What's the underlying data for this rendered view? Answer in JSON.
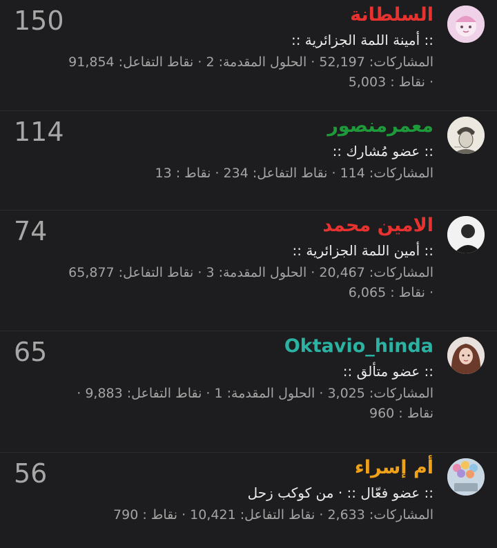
{
  "members": [
    {
      "count": "150",
      "username": "السلطانة",
      "username_color": "#e8322f",
      "title": ":: أمينة اللمة الجزائرية ::",
      "stats_line1": "المشاركات: 52,197 · الحلول المقدمة: 2 · نقاط التفاعل: 91,854",
      "stats_line2": "· نقاط : 5,003",
      "avatar": "pink-cartoon-avatar"
    },
    {
      "count": "114",
      "username": "معمرمنصور",
      "username_color": "#1f9a3b",
      "title": ":: عضو مُشارك ::",
      "stats_line1": "المشاركات: 114 · نقاط التفاعل: 234 · نقاط : 13",
      "stats_line2": "",
      "avatar": "sketch-portrait-avatar"
    },
    {
      "count": "74",
      "username": "الامين محمد",
      "username_color": "#e8322f",
      "title": ":: أمين اللمة الجزائرية ::",
      "stats_line1": "المشاركات: 20,467 · الحلول المقدمة: 3 · نقاط التفاعل: 65,877",
      "stats_line2": "· نقاط : 6,065",
      "avatar": "person-photo-avatar"
    },
    {
      "count": "65",
      "username": "Oktavio_hinda",
      "username_color": "#2ab3a3",
      "title": ":: عضو متألق ::",
      "stats_line1": "المشاركات: 3,025 · الحلول المقدمة: 1 · نقاط التفاعل: 9,883 ·",
      "stats_line2": "نقاط : 960",
      "avatar": "girl-portrait-avatar"
    },
    {
      "count": "56",
      "username": "أم إسراء",
      "username_color": "#f0a11a",
      "title": ":: عضو فعّال :: · من كوكب زحل",
      "stats_line1": "المشاركات: 2,633 · نقاط التفاعل: 10,421 · نقاط : 790",
      "stats_line2": "",
      "avatar": "balloons-avatar"
    }
  ]
}
